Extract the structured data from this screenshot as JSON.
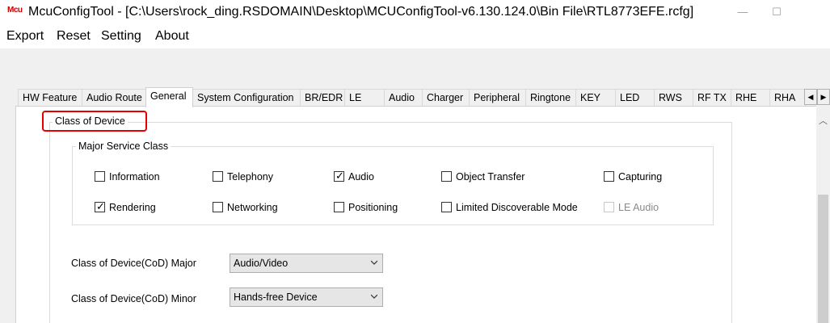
{
  "window": {
    "title": "McuConfigTool - [C:\\Users\\rock_ding.RSDOMAIN\\Desktop\\MCUConfigTool-v6.130.124.0\\Bin File\\RTL8773EFE.rcfg]",
    "icon_text": "Mcu"
  },
  "menu": [
    "Export",
    "Reset",
    "Setting",
    "About"
  ],
  "tabs": [
    "HW Feature",
    "Audio Route",
    "General",
    "System Configuration",
    "BR/EDR",
    "LE",
    "Audio",
    "Charger",
    "Peripheral",
    "Ringtone",
    "KEY",
    "LED",
    "RWS",
    "RF TX",
    "RHE",
    "RHA"
  ],
  "active_tab": "General",
  "class_of_device": {
    "title": "Class of Device",
    "major_service_class": {
      "title": "Major Service Class",
      "options": [
        {
          "label": "Information",
          "checked": false,
          "enabled": true
        },
        {
          "label": "Telephony",
          "checked": false,
          "enabled": true
        },
        {
          "label": "Audio",
          "checked": true,
          "enabled": true
        },
        {
          "label": "Object Transfer",
          "checked": false,
          "enabled": true
        },
        {
          "label": "Capturing",
          "checked": false,
          "enabled": true
        },
        {
          "label": "Rendering",
          "checked": true,
          "enabled": true
        },
        {
          "label": "Networking",
          "checked": false,
          "enabled": true
        },
        {
          "label": "Positioning",
          "checked": false,
          "enabled": true
        },
        {
          "label": "Limited Discoverable Mode",
          "checked": false,
          "enabled": true
        },
        {
          "label": "LE Audio",
          "checked": false,
          "enabled": false
        }
      ]
    },
    "cod_major": {
      "label": "Class of Device(CoD) Major",
      "value": "Audio/Video"
    },
    "cod_minor": {
      "label": "Class of Device(CoD) Minor",
      "value": "Hands-free Device"
    }
  },
  "colors": {
    "highlight": "#e60000",
    "pane_bg": "#ffffff",
    "window_bg": "#f0f0f0"
  }
}
